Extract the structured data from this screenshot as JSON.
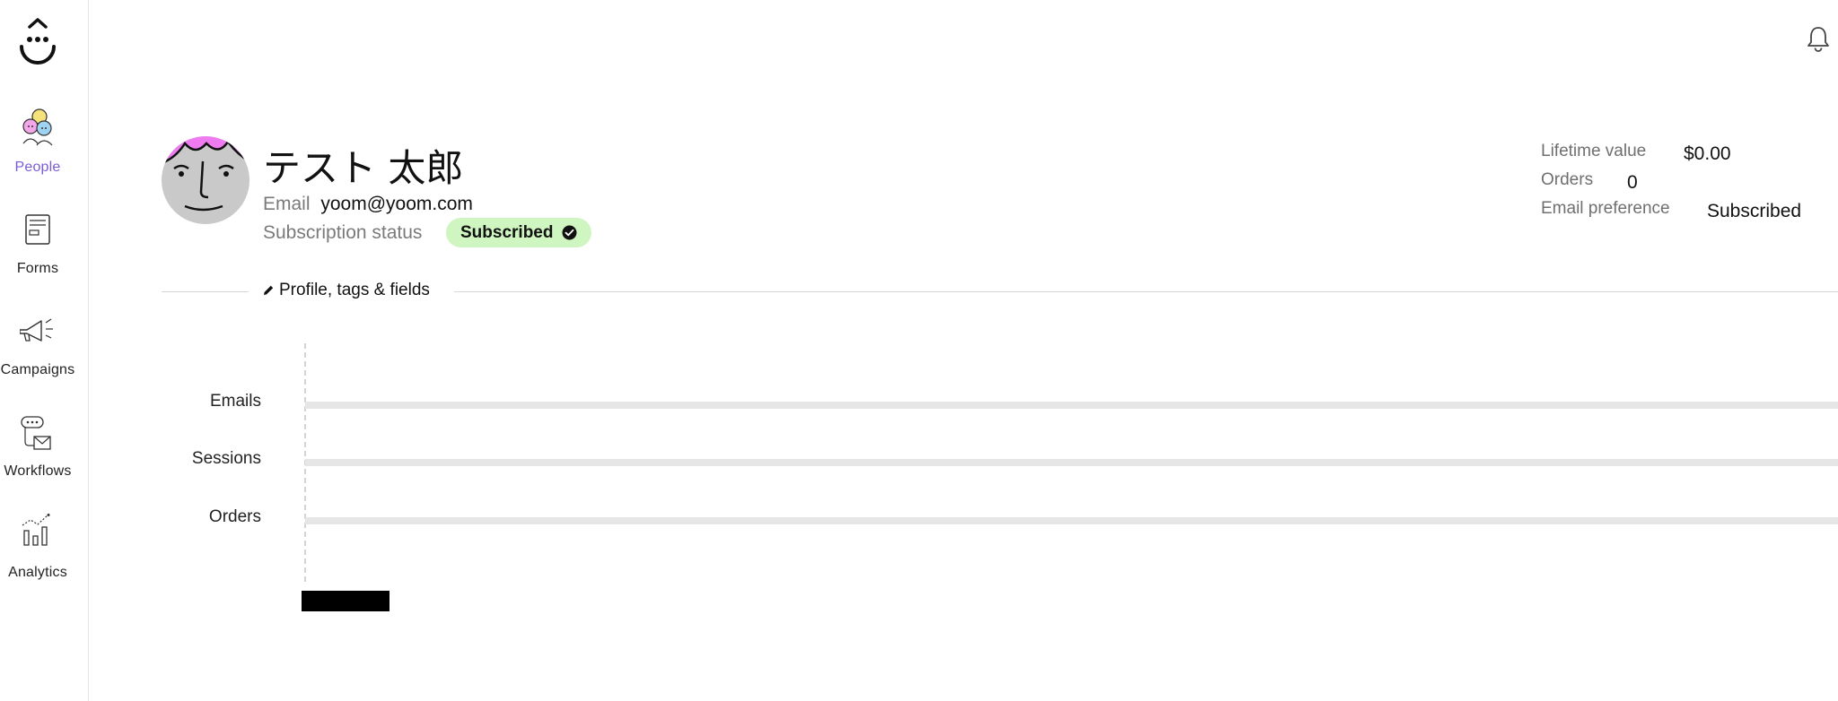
{
  "sidebar": {
    "items": [
      {
        "label": "People",
        "icon": "people-icon",
        "active": true
      },
      {
        "label": "Forms",
        "icon": "form-icon",
        "active": false
      },
      {
        "label": "Campaigns",
        "icon": "megaphone-icon",
        "active": false
      },
      {
        "label": "Workflows",
        "icon": "workflow-icon",
        "active": false
      },
      {
        "label": "Analytics",
        "icon": "analytics-icon",
        "active": false
      }
    ]
  },
  "header": {
    "notifications_icon": "bell-icon"
  },
  "profile": {
    "name": "テスト 太郎",
    "email_label": "Email",
    "email": "yoom@yoom.com",
    "subscription_label": "Subscription status",
    "subscription_status": "Subscribed"
  },
  "stats": {
    "lifetime_value_label": "Lifetime value",
    "lifetime_value": "$0.00",
    "orders_label": "Orders",
    "orders": "0",
    "email_preference_label": "Email preference",
    "email_preference": "Subscribed"
  },
  "tabs": {
    "profile_label": "Profile, tags & fields"
  },
  "timeline": {
    "rows": [
      "Emails",
      "Sessions",
      "Orders"
    ]
  },
  "colors": {
    "accent": "#7a5cd6",
    "badge_bg": "#cff5c0",
    "avatar_hair": "#ee7cf0",
    "avatar_face": "#c9c9c9"
  }
}
